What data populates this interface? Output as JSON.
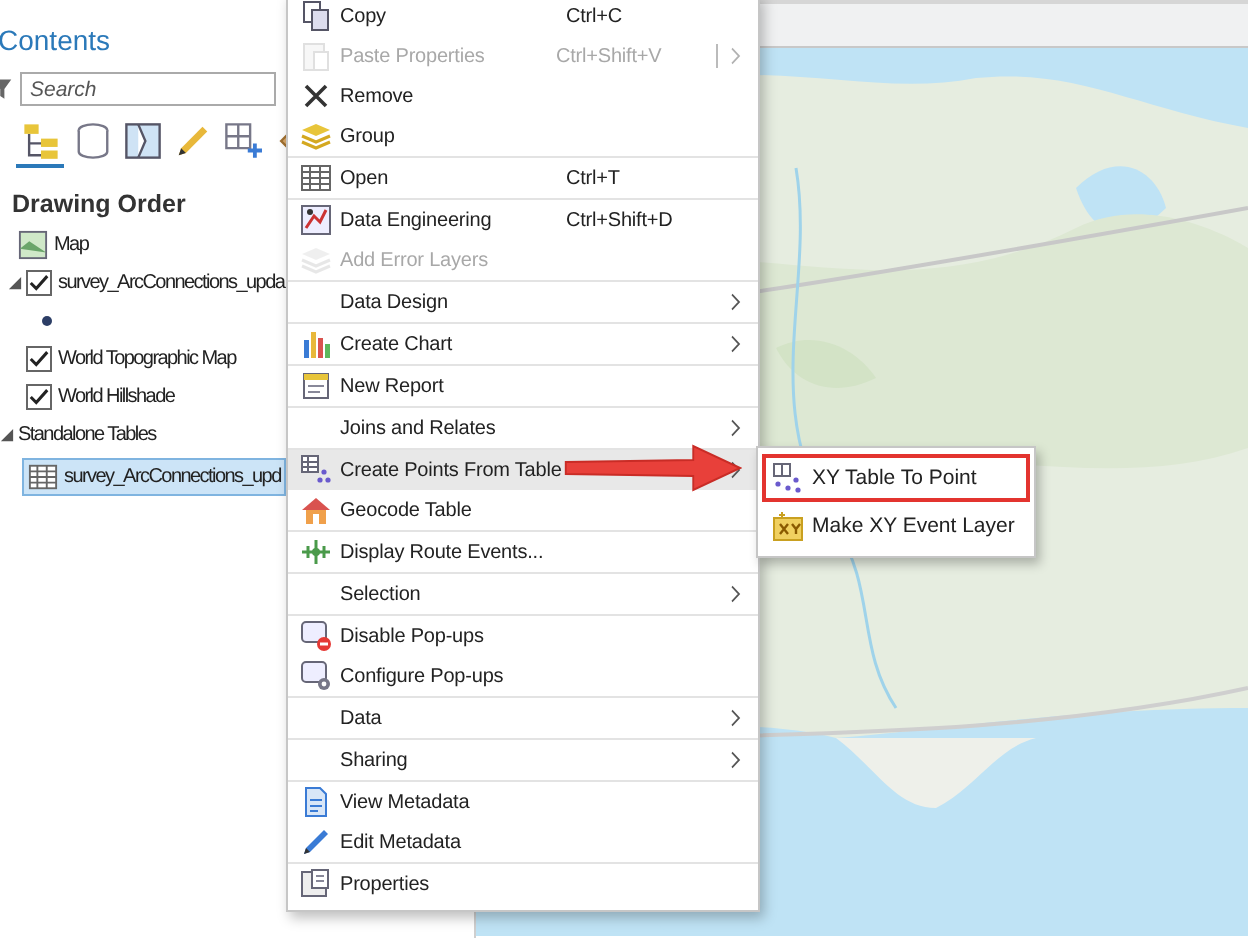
{
  "contents": {
    "title": "Contents",
    "search": {
      "placeholder": "Search"
    },
    "view_tabs": [
      {
        "kind": "drawing-order",
        "selected": true
      },
      {
        "kind": "source",
        "selected": false
      },
      {
        "kind": "selection",
        "selected": false
      },
      {
        "kind": "editing",
        "selected": false
      },
      {
        "kind": "snapping",
        "selected": false
      },
      {
        "kind": "labeling",
        "selected": false
      }
    ],
    "heading": "Drawing Order",
    "tree": [
      {
        "label": "Map",
        "kind": "map",
        "children": [
          {
            "label": "survey_ArcConnections_upda",
            "kind": "layer",
            "checked": true,
            "expanded": true,
            "children": [
              {
                "kind": "point-symbol"
              }
            ]
          },
          {
            "label": "World Topographic Map",
            "kind": "layer",
            "checked": true
          },
          {
            "label": "World Hillshade",
            "kind": "layer",
            "checked": true
          }
        ]
      },
      {
        "label": "Standalone Tables",
        "kind": "group",
        "expanded": true,
        "children": [
          {
            "label": "survey_ArcConnections_upd",
            "kind": "table",
            "selected": true
          }
        ]
      }
    ]
  },
  "context_menu": {
    "items": [
      {
        "label": "Copy",
        "kind": "copy",
        "shortcut": "Ctrl+C",
        "disabled": false,
        "submenu": false,
        "separator_before": false,
        "highlighted": false
      },
      {
        "label": "Paste Properties",
        "kind": "paste",
        "shortcut": "Ctrl+Shift+V",
        "disabled": true,
        "submenu": true,
        "separator_before": false,
        "highlighted": false
      },
      {
        "label": "Remove",
        "kind": "remove",
        "disabled": false,
        "submenu": false,
        "separator_before": false,
        "highlighted": false
      },
      {
        "label": "Group",
        "kind": "group",
        "disabled": false,
        "submenu": false,
        "separator_before": false,
        "highlighted": false
      },
      {
        "label": "Open",
        "kind": "table",
        "shortcut": "Ctrl+T",
        "disabled": false,
        "submenu": false,
        "separator_before": true,
        "highlighted": false
      },
      {
        "label": "Data Engineering",
        "kind": "engineering",
        "shortcut": "Ctrl+Shift+D",
        "disabled": false,
        "submenu": false,
        "separator_before": true,
        "highlighted": false
      },
      {
        "label": "Add Error Layers",
        "kind": "error-layers",
        "disabled": true,
        "submenu": false,
        "separator_before": false,
        "highlighted": false
      },
      {
        "label": "Data Design",
        "kind": "plain",
        "disabled": false,
        "submenu": true,
        "separator_before": true,
        "highlighted": false
      },
      {
        "label": "Create Chart",
        "kind": "chart",
        "disabled": false,
        "submenu": true,
        "separator_before": true,
        "highlighted": false
      },
      {
        "label": "New Report",
        "kind": "report",
        "disabled": false,
        "submenu": false,
        "separator_before": true,
        "highlighted": false
      },
      {
        "label": "Joins and Relates",
        "kind": "plain",
        "disabled": false,
        "submenu": true,
        "separator_before": true,
        "highlighted": false
      },
      {
        "label": "Create Points From Table",
        "kind": "points",
        "disabled": false,
        "submenu": true,
        "separator_before": true,
        "highlighted": true
      },
      {
        "label": "Geocode Table",
        "kind": "geocode",
        "disabled": false,
        "submenu": false,
        "separator_before": false,
        "highlighted": false
      },
      {
        "label": "Display Route Events...",
        "kind": "route",
        "disabled": false,
        "submenu": false,
        "separator_before": true,
        "highlighted": false
      },
      {
        "label": "Selection",
        "kind": "plain",
        "disabled": false,
        "submenu": true,
        "separator_before": true,
        "highlighted": false
      },
      {
        "label": "Disable Pop-ups",
        "kind": "disable-popup",
        "disabled": false,
        "submenu": false,
        "separator_before": true,
        "highlighted": false
      },
      {
        "label": "Configure Pop-ups",
        "kind": "configure-popup",
        "disabled": false,
        "submenu": false,
        "separator_before": false,
        "highlighted": false
      },
      {
        "label": "Data",
        "kind": "plain",
        "disabled": false,
        "submenu": true,
        "separator_before": true,
        "highlighted": false
      },
      {
        "label": "Sharing",
        "kind": "plain",
        "disabled": false,
        "submenu": true,
        "separator_before": true,
        "highlighted": false
      },
      {
        "label": "View Metadata",
        "kind": "metadata",
        "disabled": false,
        "submenu": false,
        "separator_before": true,
        "highlighted": false
      },
      {
        "label": "Edit Metadata",
        "kind": "edit",
        "disabled": false,
        "submenu": false,
        "separator_before": false,
        "highlighted": false
      },
      {
        "label": "Properties",
        "kind": "properties",
        "disabled": false,
        "submenu": false,
        "separator_before": true,
        "highlighted": false
      }
    ]
  },
  "submenu": {
    "items": [
      {
        "label": "XY Table To Point",
        "kind": "xy-points",
        "outlined": true
      },
      {
        "label": "Make XY Event Layer",
        "kind": "xy-layer",
        "outlined": false
      }
    ]
  }
}
